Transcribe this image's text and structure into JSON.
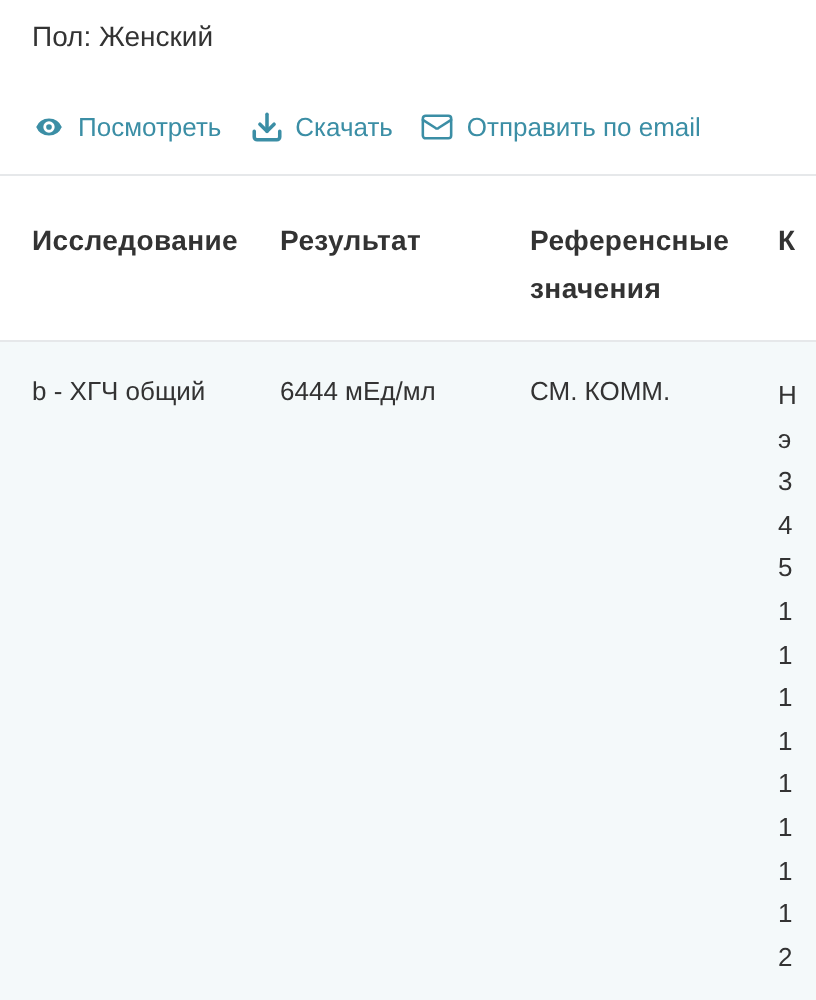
{
  "gender": "Пол: Женский",
  "actions": [
    {
      "kind": "view",
      "label": "Посмотреть"
    },
    {
      "kind": "download",
      "label": "Скачать"
    },
    {
      "kind": "email",
      "label": "Отправить по email"
    }
  ],
  "table": {
    "columns": [
      "Исследование",
      "Результат",
      "Референсные значения",
      "К"
    ],
    "rows": [
      {
        "cells": [
          "b - ХГЧ общий",
          "6444 мЕд/мл",
          "СМ. КОММ."
        ],
        "column_4": [
          "Н",
          "э",
          "3",
          "4",
          "5",
          "1",
          "1",
          "1",
          "1",
          "1",
          "1",
          "1",
          "1",
          "2"
        ]
      }
    ]
  }
}
